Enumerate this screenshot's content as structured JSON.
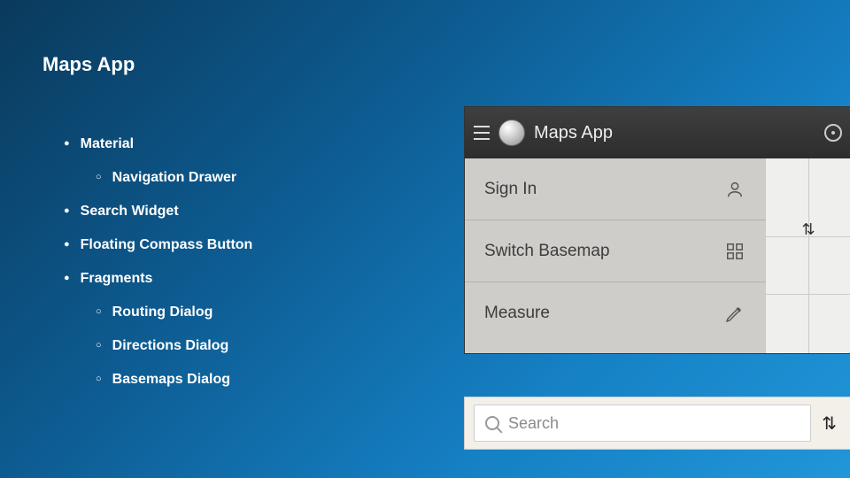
{
  "title": "Maps App",
  "bullets": {
    "material": "Material",
    "material_sub": [
      "Navigation Drawer"
    ],
    "items": [
      "Search Widget",
      "Floating Compass Button",
      "Fragments"
    ],
    "fragments_sub": [
      "Routing Dialog",
      "Directions Dialog",
      "Basemaps Dialog"
    ]
  },
  "drawer": {
    "app_title": "Maps App",
    "rows": [
      {
        "label": "Sign In",
        "icon": "person"
      },
      {
        "label": "Switch Basemap",
        "icon": "grid"
      },
      {
        "label": "Measure",
        "icon": "pencil"
      }
    ],
    "compass": "⇅"
  },
  "search": {
    "placeholder": "Search",
    "compass": "⇅"
  }
}
